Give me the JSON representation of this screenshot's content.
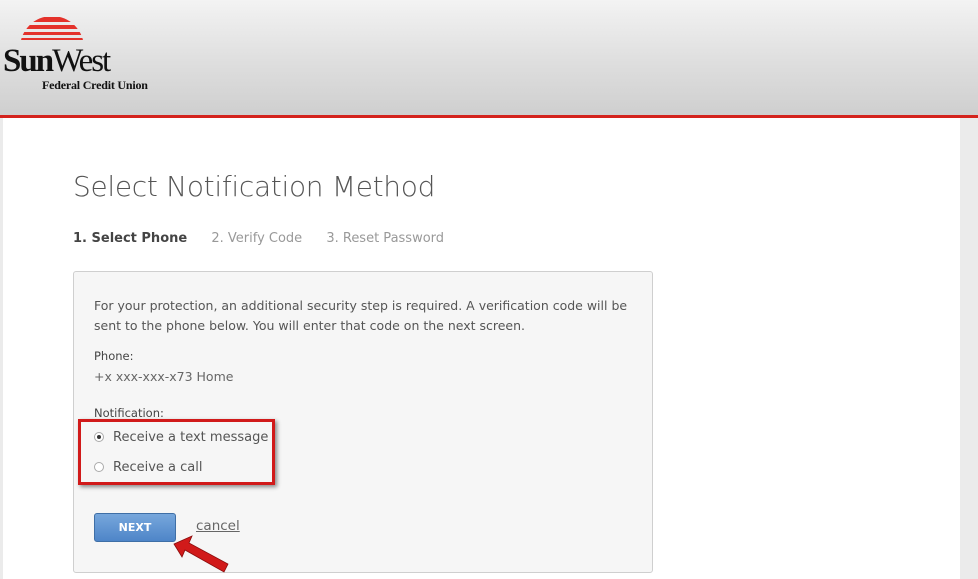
{
  "brand": {
    "name_bold": "Sun",
    "name_light": "West",
    "subtitle": "Federal Credit Union",
    "colors": {
      "accent": "#d4231d",
      "button": "#5a8fd0"
    }
  },
  "page": {
    "title": "Select Notification Method"
  },
  "steps": [
    {
      "label": "1. Select Phone",
      "active": true
    },
    {
      "label": "2. Verify Code",
      "active": false
    },
    {
      "label": "3. Reset Password",
      "active": false
    }
  ],
  "panel": {
    "intro": "For your protection, an additional security step is required. A verification code will be sent to the phone below. You will enter that code on the next screen.",
    "phone_label": "Phone:",
    "phone_value": "+x xxx-xxx-x73 Home",
    "notification_label": "Notification:",
    "options": [
      {
        "label": "Receive a text message",
        "selected": true
      },
      {
        "label": "Receive a call",
        "selected": false
      }
    ],
    "next_label": "NEXT",
    "cancel_label": "cancel"
  },
  "icons": {
    "logo": "sun-stripes-logo",
    "annotation": "red-arrow-icon"
  }
}
